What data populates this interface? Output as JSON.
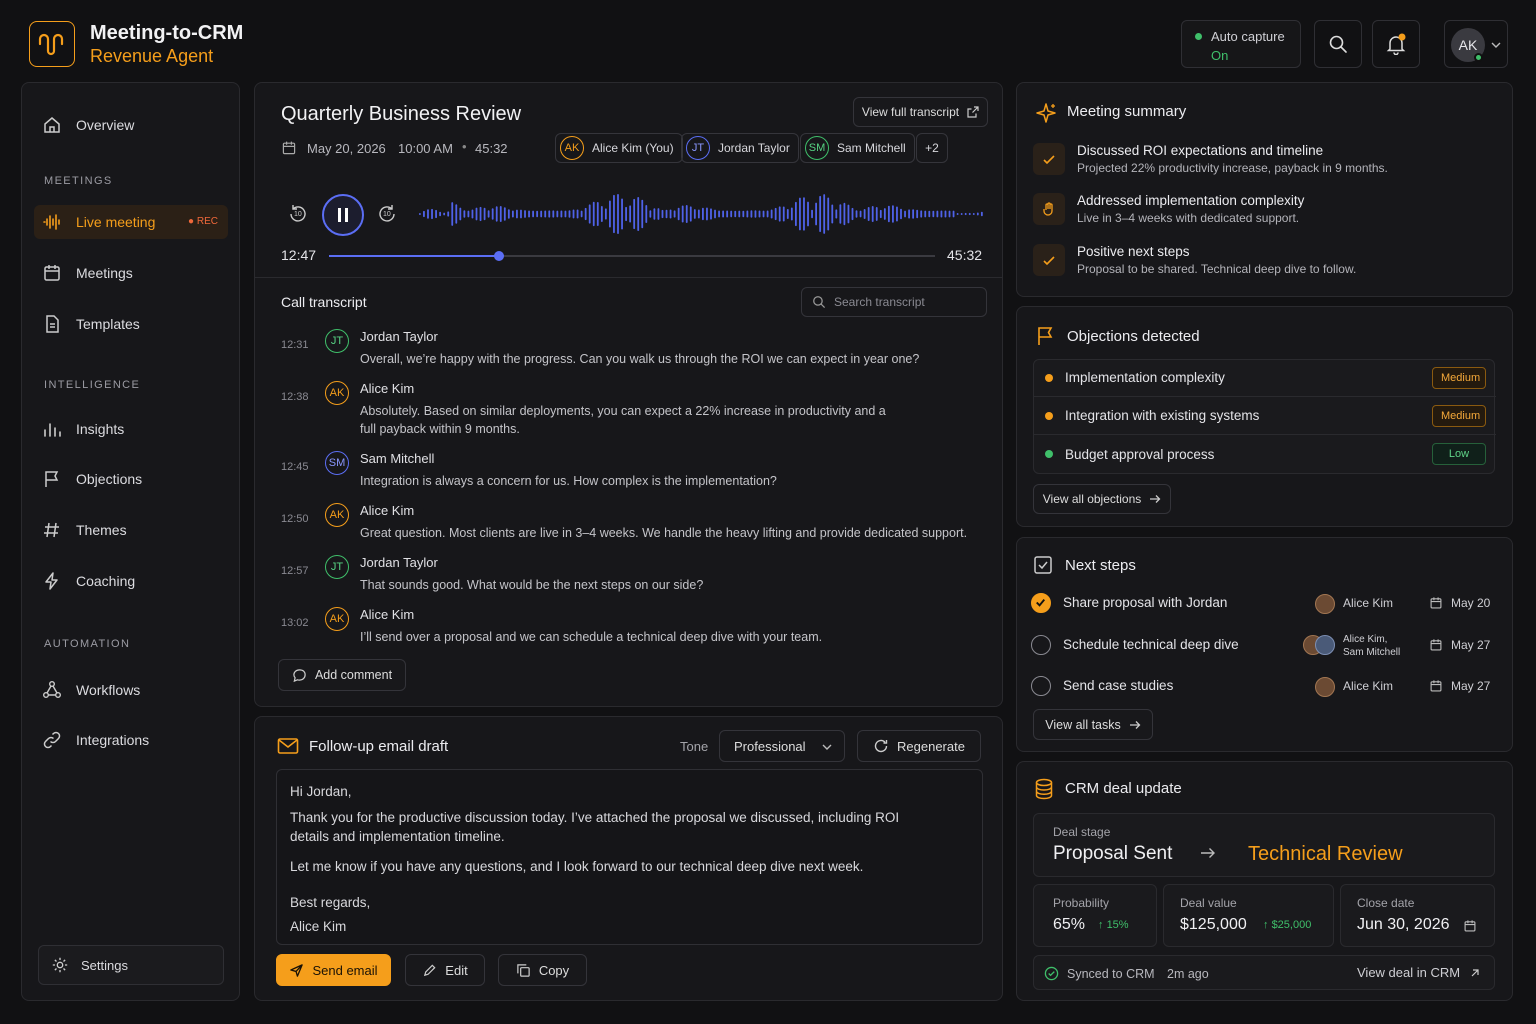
{
  "app": {
    "title": "Meeting-to-CRM",
    "subtitle": "Revenue Agent"
  },
  "header": {
    "auto_capture_label": "Auto capture",
    "auto_capture_value": "On",
    "user_initials": "AK"
  },
  "sidebar": {
    "overview": "Overview",
    "sections": {
      "meetings": "MEETINGS",
      "intelligence": "INTELLIGENCE",
      "automation": "AUTOMATION"
    },
    "live_meeting": "Live meeting",
    "rec": "REC",
    "meetings": "Meetings",
    "templates": "Templates",
    "insights": "Insights",
    "objections": "Objections",
    "themes": "Themes",
    "coaching": "Coaching",
    "workflows": "Workflows",
    "integrations": "Integrations",
    "settings": "Settings"
  },
  "meeting": {
    "title": "Quarterly Business Review",
    "view_transcript": "View full transcript",
    "date": "May 20, 2026",
    "time": "10:00 AM",
    "duration": "45:32",
    "participants": [
      {
        "initials": "AK",
        "name": "Alice Kim (You)"
      },
      {
        "initials": "JT",
        "name": "Jordan Taylor"
      },
      {
        "initials": "SM",
        "name": "Sam Mitchell"
      }
    ],
    "more": "+2",
    "skip_back": "10",
    "skip_fwd": "10",
    "current_time": "12:47",
    "total_time": "45:32",
    "progress": 0.28
  },
  "transcript": {
    "title": "Call transcript",
    "search_placeholder": "Search transcript",
    "entries": [
      {
        "time": "12:31",
        "initials": "JT",
        "speaker": "Jordan Taylor",
        "text": "Overall, we’re happy with the progress. Can you walk us through the ROI we can expect in year one?"
      },
      {
        "time": "12:38",
        "initials": "AK",
        "speaker": "Alice Kim",
        "text": "Absolutely. Based on similar deployments, you can expect a 22% increase in productivity and a full payback within 9 months."
      },
      {
        "time": "12:45",
        "initials": "SM",
        "speaker": "Sam Mitchell",
        "text": "Integration is always a concern for us. How complex is the implementation?"
      },
      {
        "time": "12:50",
        "initials": "AK",
        "speaker": "Alice Kim",
        "text": "Great question. Most clients are live in 3–4 weeks. We handle the heavy lifting and provide dedicated support."
      },
      {
        "time": "12:57",
        "initials": "JT",
        "speaker": "Jordan Taylor",
        "text": "That sounds good. What would be the next steps on our side?"
      },
      {
        "time": "13:02",
        "initials": "AK",
        "speaker": "Alice Kim",
        "text": "I’ll send over a proposal and we can schedule a technical deep dive with your team."
      }
    ],
    "add_comment": "Add comment"
  },
  "email": {
    "title": "Follow-up email draft",
    "tone_label": "Tone",
    "tone_value": "Professional",
    "regenerate": "Regenerate",
    "greeting": "Hi Jordan,",
    "para1": "Thank you for the productive discussion today. I’ve attached the proposal we discussed, including ROI details and implementation timeline.",
    "para2": "Let me know if you have any questions, and I look forward to our technical deep dive next week.",
    "signoff": "Best regards,",
    "signature": "Alice Kim",
    "send": "Send email",
    "edit": "Edit",
    "copy": "Copy"
  },
  "summary": {
    "title": "Meeting summary",
    "items": [
      {
        "title": "Discussed ROI expectations and timeline",
        "detail": "Projected 22% productivity increase, payback in 9 months."
      },
      {
        "title": "Addressed implementation complexity",
        "detail": "Live in 3–4 weeks with dedicated support."
      },
      {
        "title": "Positive next steps",
        "detail": "Proposal to be shared. Technical deep dive to follow."
      }
    ]
  },
  "objections": {
    "title": "Objections detected",
    "items": [
      {
        "label": "Implementation complexity",
        "severity": "Medium"
      },
      {
        "label": "Integration with existing systems",
        "severity": "Medium"
      },
      {
        "label": "Budget approval process",
        "severity": "Low"
      }
    ],
    "view_all": "View all objections"
  },
  "next_steps": {
    "title": "Next steps",
    "items": [
      {
        "label": "Share proposal with Jordan",
        "assignee": "Alice Kim",
        "date": "May 20",
        "done": true
      },
      {
        "label": "Schedule technical deep dive",
        "assignee_line1": "Alice Kim,",
        "assignee_line2": "Sam Mitchell",
        "date": "May 27",
        "done": false
      },
      {
        "label": "Send case studies",
        "assignee": "Alice Kim",
        "date": "May 27",
        "done": false
      }
    ],
    "view_all": "View all tasks"
  },
  "crm": {
    "title": "CRM deal update",
    "stage_label": "Deal stage",
    "stage_from": "Proposal Sent",
    "stage_to": "Technical Review",
    "probability_label": "Probability",
    "probability": "65%",
    "probability_delta": "15%",
    "value_label": "Deal value",
    "value": "$125,000",
    "value_delta": "$25,000",
    "close_label": "Close date",
    "close": "Jun 30, 2026",
    "synced": "Synced to CRM",
    "synced_time": "2m ago",
    "view_deal": "View deal in CRM"
  },
  "colors": {
    "accent": "#f59e1b",
    "blue": "#5b6ef5",
    "green": "#3fbf6a",
    "bg": "#111113",
    "panel": "#17171a"
  }
}
